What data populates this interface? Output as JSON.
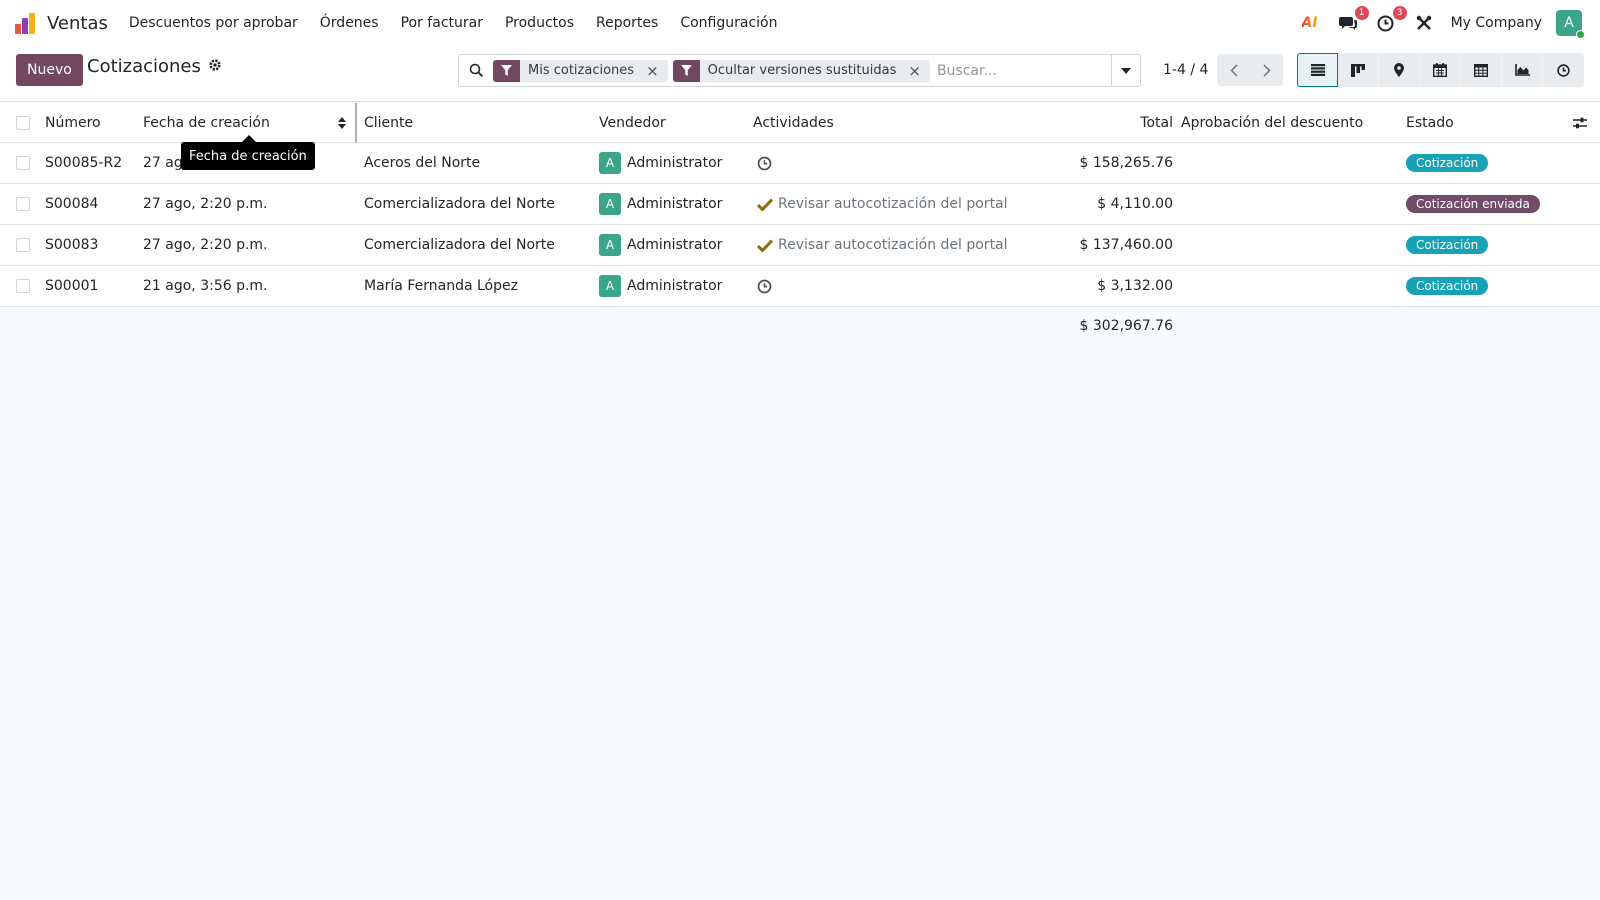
{
  "navbar": {
    "app_name": "Ventas",
    "logo_colors": [
      "#f0563e",
      "#8e3fb3",
      "#f7b11a"
    ],
    "menu": [
      {
        "label": "Descuentos por aprobar"
      },
      {
        "label": "Órdenes"
      },
      {
        "label": "Por facturar"
      },
      {
        "label": "Productos"
      },
      {
        "label": "Reportes"
      },
      {
        "label": "Configuración"
      }
    ],
    "ai_icon_text": "AI",
    "messages_count": "1",
    "activities_count": "3",
    "company": "My Company",
    "user_initial": "A"
  },
  "control": {
    "new_button": "Nuevo",
    "title": "Cotizaciones",
    "facets": [
      {
        "label": "Mis cotizaciones",
        "icon": "filter-icon"
      },
      {
        "label": "Ocultar versiones sustituidas",
        "icon": "filter-icon"
      }
    ],
    "search_placeholder": "Buscar...",
    "pager": "1-4 / 4",
    "views": [
      "list-view-icon",
      "kanban-view-icon",
      "map-view-icon",
      "calendar-view-icon",
      "pivot-view-icon",
      "graph-view-icon",
      "activity-view-icon"
    ],
    "accent_color": "#71485f"
  },
  "list": {
    "columns": {
      "number": "Número",
      "date": "Fecha de creación",
      "customer": "Cliente",
      "seller": "Vendedor",
      "activities": "Actividades",
      "total": "Total",
      "discount_approval": "Aprobación del descuento",
      "status": "Estado"
    },
    "rows": [
      {
        "number": "S00085-R2",
        "date": "27 ago, 2:20 p.m.",
        "customer": "Aceros del Norte",
        "seller_initial": "A",
        "seller": "Administrator",
        "activity": "",
        "activity_icon": "clock-icon",
        "total": "$ 158,265.76",
        "discount_approval": "",
        "status": "Cotización",
        "status_color": "#17a2b8"
      },
      {
        "number": "S00084",
        "date": "27 ago, 2:20 p.m.",
        "customer": "Comercializadora del Norte",
        "seller_initial": "A",
        "seller": "Administrator",
        "activity": "Revisar autocotización del portal",
        "activity_icon": "check-icon",
        "total": "$ 4,110.00",
        "discount_approval": "",
        "status": "Cotización enviada",
        "status_color": "#714b67"
      },
      {
        "number": "S00083",
        "date": "27 ago, 2:20 p.m.",
        "customer": "Comercializadora del Norte",
        "seller_initial": "A",
        "seller": "Administrator",
        "activity": "Revisar autocotización del portal",
        "activity_icon": "check-icon",
        "total": "$ 137,460.00",
        "discount_approval": "",
        "status": "Cotización",
        "status_color": "#17a2b8"
      },
      {
        "number": "S00001",
        "date": "21 ago, 3:56 p.m.",
        "customer": "María Fernanda López",
        "seller_initial": "A",
        "seller": "Administrator",
        "activity": "",
        "activity_icon": "clock-icon",
        "total": "$ 3,132.00",
        "discount_approval": "",
        "status": "Cotización",
        "status_color": "#17a2b8"
      }
    ],
    "grand_total": "$ 302,967.76"
  },
  "tooltip": "Fecha de creación"
}
